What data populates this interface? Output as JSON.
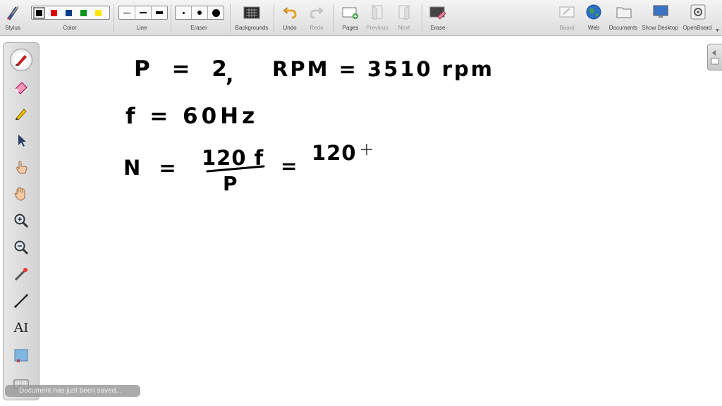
{
  "toolbar": {
    "stylus_label": "Stylus",
    "color_label": "Color",
    "line_label": "Line",
    "eraser_label": "Eraser",
    "backgrounds_label": "Backgrounds",
    "undo_label": "Undo",
    "redo_label": "Redo",
    "pages_label": "Pages",
    "previous_label": "Previous",
    "next_label": "Next",
    "erase_label": "Erase",
    "board_label": "Board",
    "web_label": "Web",
    "documents_label": "Documents",
    "show_desktop_label": "Show Desktop",
    "openboard_label": "OpenBoard",
    "colors": [
      "#000000",
      "#e00000",
      "#003c8c",
      "#00961e",
      "#ffe600"
    ],
    "selected_color": "#000000"
  },
  "sidebar": {
    "tools": [
      "pen-icon",
      "eraser-icon",
      "highlighter-icon",
      "pointer-icon",
      "hand-pointer-icon",
      "hand-pan-icon",
      "zoom-in-icon",
      "zoom-out-icon",
      "laser-pointer-icon",
      "line-icon",
      "text-icon",
      "capture-icon",
      "keyboard-icon"
    ],
    "text_tool_glyph": "A"
  },
  "status": {
    "toast": "Document has just been saved..."
  },
  "board": {
    "line1_p": "P = 2",
    "line1_comma": ",",
    "line1_rpm": "RPM = 3510 rpm",
    "line2": "f = 60Hz",
    "line3_n": "N =",
    "numerator": "120 f",
    "denominator": "P",
    "equals": "=",
    "result": "120"
  }
}
